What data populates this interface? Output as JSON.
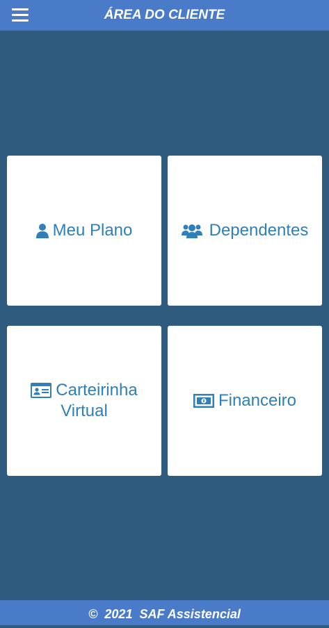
{
  "header": {
    "title": "ÁREA DO CLIENTE",
    "menu_icon": "hamburger-menu-icon"
  },
  "tiles": [
    {
      "label": "Meu Plano",
      "icon": "user-icon"
    },
    {
      "label": "Dependentes",
      "icon": "users-group-icon"
    },
    {
      "label_line1": "Carteirinha",
      "label_line2": "Virtual",
      "icon": "id-card-icon"
    },
    {
      "label": "Financeiro",
      "icon": "money-bill-icon"
    }
  ],
  "footer": {
    "text": "©  2021  SAF Assistencial"
  },
  "colors": {
    "background": "#2e5b7e",
    "bars": "#4a7bc8",
    "accent": "#2f7fb8",
    "tile": "#ffffff"
  }
}
